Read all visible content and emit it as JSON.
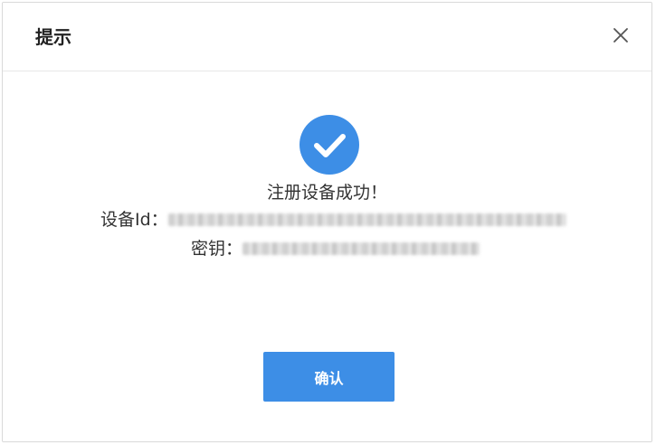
{
  "dialog": {
    "title": "提示",
    "close_icon": "close-icon",
    "success_icon": "check-circle-icon",
    "message": "注册设备成功！",
    "device_id_label": "设备Id：",
    "secret_label": "密钥：",
    "confirm_label": "确认"
  },
  "colors": {
    "accent": "#3d8ee6",
    "text": "#333333",
    "border": "#d9d9d9"
  }
}
